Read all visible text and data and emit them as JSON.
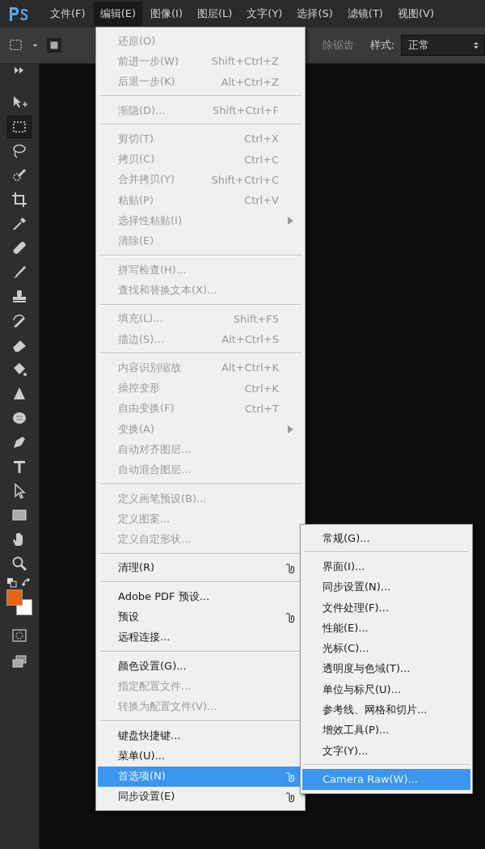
{
  "menubar": {
    "items": [
      {
        "label": "文件(F)",
        "selected": false
      },
      {
        "label": "编辑(E)",
        "selected": true
      },
      {
        "label": "图像(I)",
        "selected": false
      },
      {
        "label": "图层(L)",
        "selected": false
      },
      {
        "label": "文字(Y)",
        "selected": false
      },
      {
        "label": "选择(S)",
        "selected": false
      },
      {
        "label": "滤镜(T)",
        "selected": false
      },
      {
        "label": "视图(V)",
        "selected": false
      }
    ]
  },
  "options_bar": {
    "antialias_label": "除锯齿",
    "style_label": "样式:",
    "style_value": "正常"
  },
  "toolbar": {
    "tools": [
      {
        "kind": "move",
        "selected": false
      },
      {
        "kind": "marquee",
        "selected": true
      },
      {
        "kind": "lasso",
        "selected": false
      },
      {
        "kind": "quickselect",
        "selected": false
      },
      {
        "kind": "crop",
        "selected": false
      },
      {
        "kind": "eyedropper",
        "selected": false
      },
      {
        "kind": "bandage",
        "selected": false
      },
      {
        "kind": "brush",
        "selected": false
      },
      {
        "kind": "stamp",
        "selected": false
      },
      {
        "kind": "historybrush",
        "selected": false
      },
      {
        "kind": "eraser",
        "selected": false
      },
      {
        "kind": "bucket",
        "selected": false
      },
      {
        "kind": "blur",
        "selected": false
      },
      {
        "kind": "sponge",
        "selected": false
      },
      {
        "kind": "pen",
        "selected": false
      },
      {
        "kind": "type",
        "selected": false
      },
      {
        "kind": "pathselect",
        "selected": false
      },
      {
        "kind": "rectangle",
        "selected": false
      },
      {
        "kind": "hand",
        "selected": false
      },
      {
        "kind": "zoom",
        "selected": false
      }
    ]
  },
  "edit_menu": {
    "groups": [
      [
        {
          "label": "还原(O)",
          "disabled": true,
          "selected": false
        },
        {
          "label": "前进一步(W)",
          "shortcut": "Shift+Ctrl+Z",
          "disabled": true,
          "selected": false
        },
        {
          "label": "后退一步(K)",
          "shortcut": "Alt+Ctrl+Z",
          "disabled": true,
          "selected": false
        }
      ],
      [
        {
          "label": "渐隐(D)...",
          "shortcut": "Shift+Ctrl+F",
          "disabled": true,
          "selected": false
        }
      ],
      [
        {
          "label": "剪切(T)",
          "shortcut": "Ctrl+X",
          "disabled": true,
          "selected": false
        },
        {
          "label": "拷贝(C)",
          "shortcut": "Ctrl+C",
          "disabled": true,
          "selected": false
        },
        {
          "label": "合并拷贝(Y)",
          "shortcut": "Shift+Ctrl+C",
          "disabled": true,
          "selected": false
        },
        {
          "label": "粘贴(P)",
          "shortcut": "Ctrl+V",
          "disabled": true,
          "selected": false
        },
        {
          "label": "选择性粘贴(I)",
          "submenu": true,
          "disabled": true,
          "selected": false
        },
        {
          "label": "清除(E)",
          "disabled": true,
          "selected": false
        }
      ],
      [
        {
          "label": "拼写检查(H)...",
          "disabled": true,
          "selected": false
        },
        {
          "label": "查找和替换文本(X)...",
          "disabled": true,
          "selected": false
        }
      ],
      [
        {
          "label": "填充(L)...",
          "shortcut": "Shift+F5",
          "disabled": true,
          "selected": false
        },
        {
          "label": "描边(S)...",
          "shortcut": "Alt+Ctrl+S",
          "disabled": true,
          "selected": false
        }
      ],
      [
        {
          "label": "内容识别缩放",
          "shortcut": "Alt+Ctrl+K",
          "disabled": true,
          "selected": false
        },
        {
          "label": "操控变形",
          "shortcut": "Ctrl+K",
          "disabled": true,
          "selected": false
        },
        {
          "label": "自由变换(F)",
          "shortcut": "Ctrl+T",
          "disabled": true,
          "selected": false
        },
        {
          "label": "变换(A)",
          "submenu": true,
          "disabled": true,
          "selected": false
        },
        {
          "label": "自动对齐图层...",
          "disabled": true,
          "selected": false
        },
        {
          "label": "自动混合图层...",
          "disabled": true,
          "selected": false
        }
      ],
      [
        {
          "label": "定义画笔预设(B)...",
          "disabled": true,
          "selected": false
        },
        {
          "label": "定义图案...",
          "disabled": true,
          "selected": false
        },
        {
          "label": "定义自定形状...",
          "disabled": true,
          "selected": false
        }
      ],
      [
        {
          "label": "清理(R)",
          "submenu": true,
          "disabled": false,
          "selected": false
        }
      ],
      [
        {
          "label": "Adobe PDF 预设...",
          "disabled": false,
          "selected": false
        },
        {
          "label": "预设",
          "submenu": true,
          "disabled": false,
          "selected": false
        },
        {
          "label": "远程连接...",
          "disabled": false,
          "selected": false
        }
      ],
      [
        {
          "label": "颜色设置(G)...",
          "disabled": false,
          "selected": false
        },
        {
          "label": "指定配置文件...",
          "disabled": true,
          "selected": false
        },
        {
          "label": "转换为配置文件(V)...",
          "disabled": true,
          "selected": false
        }
      ],
      [
        {
          "label": "键盘快捷键...",
          "disabled": false,
          "selected": false
        },
        {
          "label": "菜单(U)...",
          "disabled": false,
          "selected": false
        },
        {
          "label": "首选项(N)",
          "submenu": true,
          "disabled": false,
          "selected": true
        },
        {
          "label": "同步设置(E)",
          "submenu": true,
          "disabled": false,
          "selected": false
        }
      ]
    ]
  },
  "preferences_submenu": {
    "groups": [
      [
        {
          "label": "常规(G)...",
          "selected": false
        }
      ],
      [
        {
          "label": "界面(I)...",
          "selected": false
        },
        {
          "label": "同步设置(N)...",
          "selected": false
        },
        {
          "label": "文件处理(F)...",
          "selected": false
        },
        {
          "label": "性能(E)...",
          "selected": false
        },
        {
          "label": "光标(C)...",
          "selected": false
        },
        {
          "label": "透明度与色域(T)...",
          "selected": false
        },
        {
          "label": "单位与标尺(U)...",
          "selected": false
        },
        {
          "label": "参考线、网格和切片...",
          "selected": false
        },
        {
          "label": "增效工具(P)...",
          "selected": false
        },
        {
          "label": "文字(Y)...",
          "selected": false
        }
      ],
      [
        {
          "label": "Camera Raw(W)...",
          "selected": true
        }
      ]
    ]
  }
}
